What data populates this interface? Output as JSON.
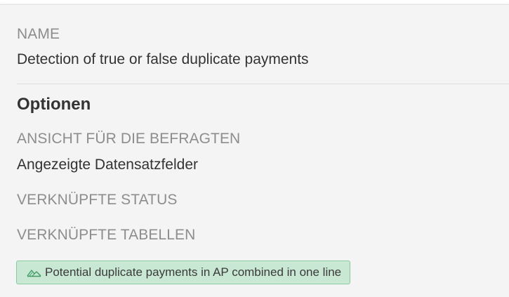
{
  "name_section": {
    "label": "NAME",
    "value": "Detection of true or false duplicate payments"
  },
  "options": {
    "heading": "Optionen",
    "respondent_view": {
      "label": "ANSICHT FÜR DIE BEFRAGTEN",
      "value": "Angezeigte Datensatzfelder"
    },
    "linked_status": {
      "label": "VERKNÜPFTE STATUS"
    },
    "linked_tables": {
      "label": "VERKNÜPFTE TABELLEN",
      "tags": [
        {
          "label": "Potential duplicate payments in AP combined in one line",
          "icon": "mountain-chart-icon"
        }
      ]
    }
  },
  "colors": {
    "panel_background": "#f4f4f4",
    "label_gray": "#8d8d8d",
    "text_dark": "#333333",
    "tag_background": "#c9e8d4",
    "tag_border": "#8cc8a2",
    "tag_icon": "#3f9a62"
  }
}
